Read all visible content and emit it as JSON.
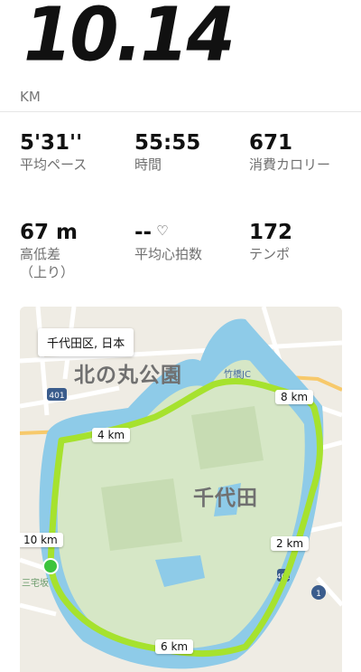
{
  "summary": {
    "distance": "10.14",
    "unit": "KM"
  },
  "stats": [
    {
      "value": "5'31''",
      "label": "平均ペース"
    },
    {
      "value": "55:55",
      "label": "時間"
    },
    {
      "value": "671",
      "label": "消費カロリー"
    },
    {
      "value": "67 m",
      "label": "高低差（上り）"
    },
    {
      "value": "--",
      "label": "平均心拍数"
    },
    {
      "value": "172",
      "label": "テンポ"
    }
  ],
  "map": {
    "location": "千代田区, 日本",
    "places": [
      "北の丸公園",
      "千代田",
      "竹橋JC",
      "三宅坂"
    ],
    "road_badges": [
      "401",
      "401",
      "1"
    ],
    "km_markers": [
      "2 km",
      "4 km",
      "6 km",
      "8 km",
      "10 km"
    ],
    "colors": {
      "route": "#a6e22e",
      "water": "#8ecbe8",
      "park": "#d4e6c3",
      "start_dot": "#3cc43c"
    }
  }
}
